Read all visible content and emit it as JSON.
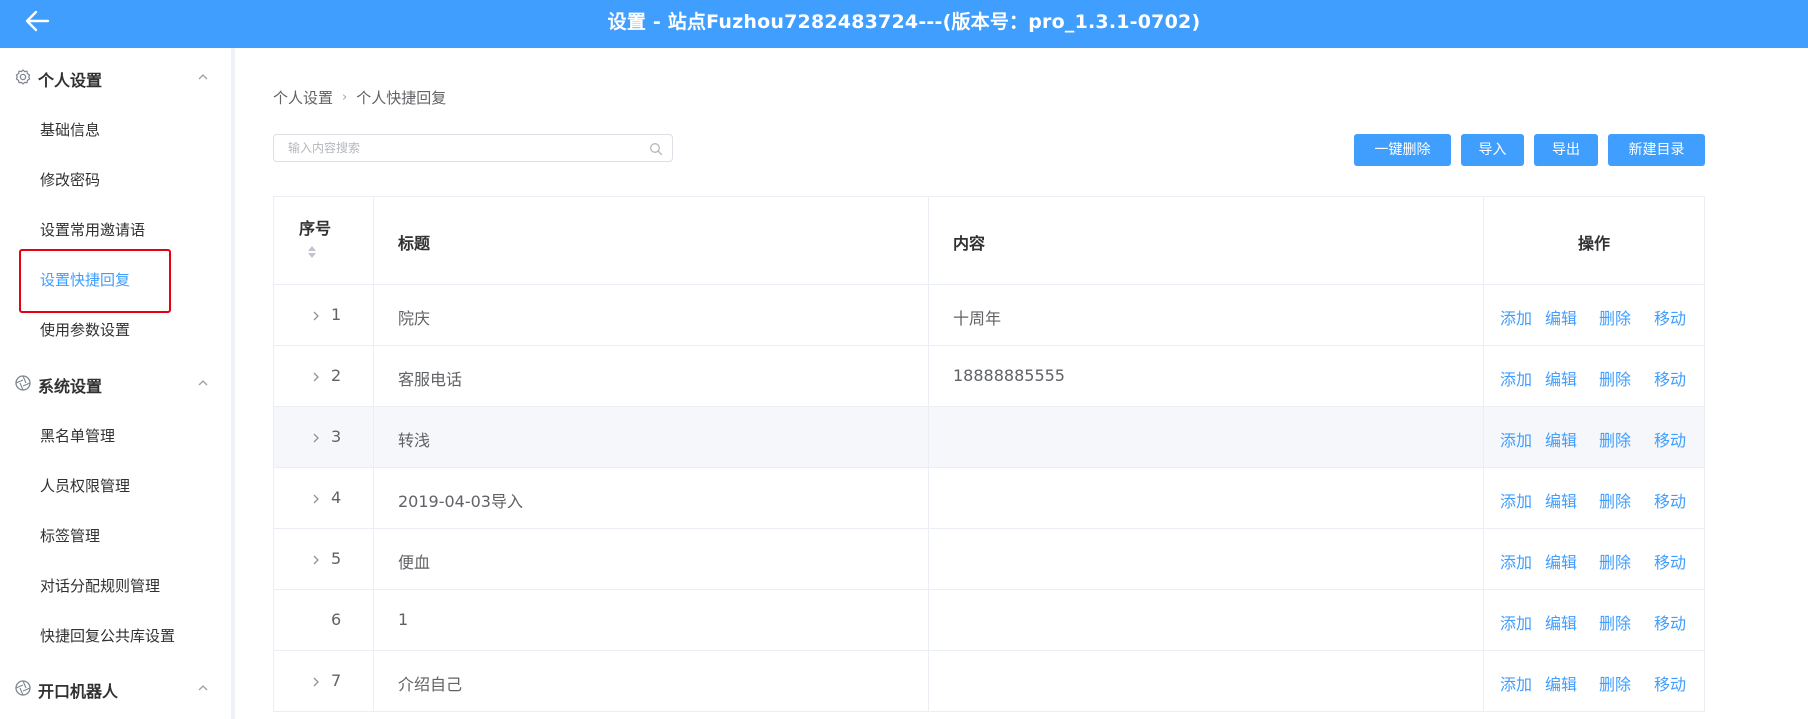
{
  "header": {
    "title": "设置 - 站点Fuzhou7282483724---(版本号：pro_1.3.1-0702)",
    "back_icon": "arrow-left-icon"
  },
  "sidebar": {
    "groups": [
      {
        "label": "个人设置",
        "icon": "gear-icon"
      },
      {
        "label": "系统设置",
        "icon": "aperture-icon"
      },
      {
        "label": "开口机器人",
        "icon": "aperture-icon"
      }
    ],
    "personal_items": [
      "基础信息",
      "修改密码",
      "设置常用邀请语",
      "设置快捷回复",
      "使用参数设置"
    ],
    "system_items": [
      "黑名单管理",
      "人员权限管理",
      "标签管理",
      "对话分配规则管理",
      "快捷回复公共库设置"
    ],
    "active_item": "设置快捷回复"
  },
  "breadcrumb": {
    "root": "个人设置",
    "current": "个人快捷回复"
  },
  "search": {
    "placeholder": "输入内容搜索",
    "value": ""
  },
  "toolbar": {
    "delete_all": "一键删除",
    "import": "导入",
    "export": "导出",
    "new_dir": "新建目录"
  },
  "table": {
    "headers": {
      "num": "序号",
      "title": "标题",
      "content": "内容",
      "ops": "操作"
    },
    "ops": {
      "add": "添加",
      "edit": "编辑",
      "delete": "删除",
      "move": "移动"
    },
    "rows": [
      {
        "num": "1",
        "title": "院庆",
        "content": "十周年",
        "expandable": true
      },
      {
        "num": "2",
        "title": "客服电话",
        "content": "18888885555",
        "expandable": true
      },
      {
        "num": "3",
        "title": "转浅",
        "content": "",
        "expandable": true
      },
      {
        "num": "4",
        "title": "2019-04-03导入",
        "content": "",
        "expandable": true
      },
      {
        "num": "5",
        "title": "便血",
        "content": "",
        "expandable": true
      },
      {
        "num": "6",
        "title": "1",
        "content": "",
        "expandable": false
      },
      {
        "num": "7",
        "title": "介绍自己",
        "content": "",
        "expandable": true
      }
    ]
  },
  "colors": {
    "accent": "#409eff",
    "highlight_border": "#e60012"
  }
}
